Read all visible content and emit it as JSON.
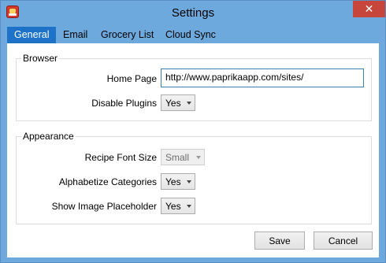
{
  "window": {
    "title": "Settings",
    "app_icon": "paprika-app-icon",
    "close_symbol": "✕"
  },
  "tabs": [
    {
      "label": "General",
      "active": true
    },
    {
      "label": "Email",
      "active": false
    },
    {
      "label": "Grocery List",
      "active": false
    },
    {
      "label": "Cloud Sync",
      "active": false
    }
  ],
  "browser": {
    "group_label": "Browser",
    "home_page_label": "Home Page",
    "home_page_value": "http://www.paprikaapp.com/sites/",
    "disable_plugins_label": "Disable Plugins",
    "disable_plugins_value": "Yes"
  },
  "appearance": {
    "group_label": "Appearance",
    "recipe_font_size_label": "Recipe Font Size",
    "recipe_font_size_value": "Small",
    "alphabetize_label": "Alphabetize Categories",
    "alphabetize_value": "Yes",
    "image_placeholder_label": "Show Image Placeholder",
    "image_placeholder_value": "Yes"
  },
  "buttons": {
    "save": "Save",
    "cancel": "Cancel"
  },
  "colors": {
    "titlebar": "#6ea9dd",
    "active_tab": "#1e73c8",
    "close_button": "#c7463b"
  }
}
